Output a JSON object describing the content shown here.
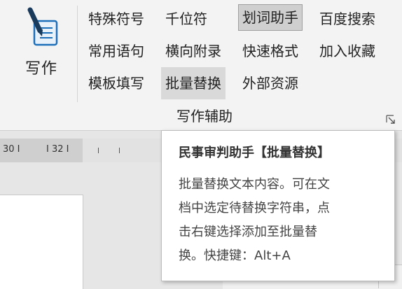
{
  "ribbon": {
    "big_button_label": "写作",
    "buttons": [
      [
        "特殊符号",
        "千位符",
        "划词助手",
        "百度搜索"
      ],
      [
        "常用语句",
        "横向附录",
        "快速格式",
        "加入收藏"
      ],
      [
        "模板填写",
        "批量替换",
        "外部资源"
      ]
    ],
    "group_label": "写作辅助"
  },
  "ruler": {
    "labels": [
      "30 I",
      "I 32 I"
    ]
  },
  "tooltip": {
    "title": "民事审判助手【批量替换】",
    "body_lines": [
      "批量替换文本内容。可在文",
      "档中选定待替换字符串，点",
      "击右键选择添加至批量替",
      "换。快捷键：Alt+A"
    ]
  },
  "colors": {
    "pressed_bg": "#cfcfcf",
    "icon_blue": "#1c6fb8",
    "icon_dark": "#1a3a5c"
  },
  "icons": {
    "big_button": "pen-document-icon",
    "launcher": "dialog-launcher-icon"
  }
}
